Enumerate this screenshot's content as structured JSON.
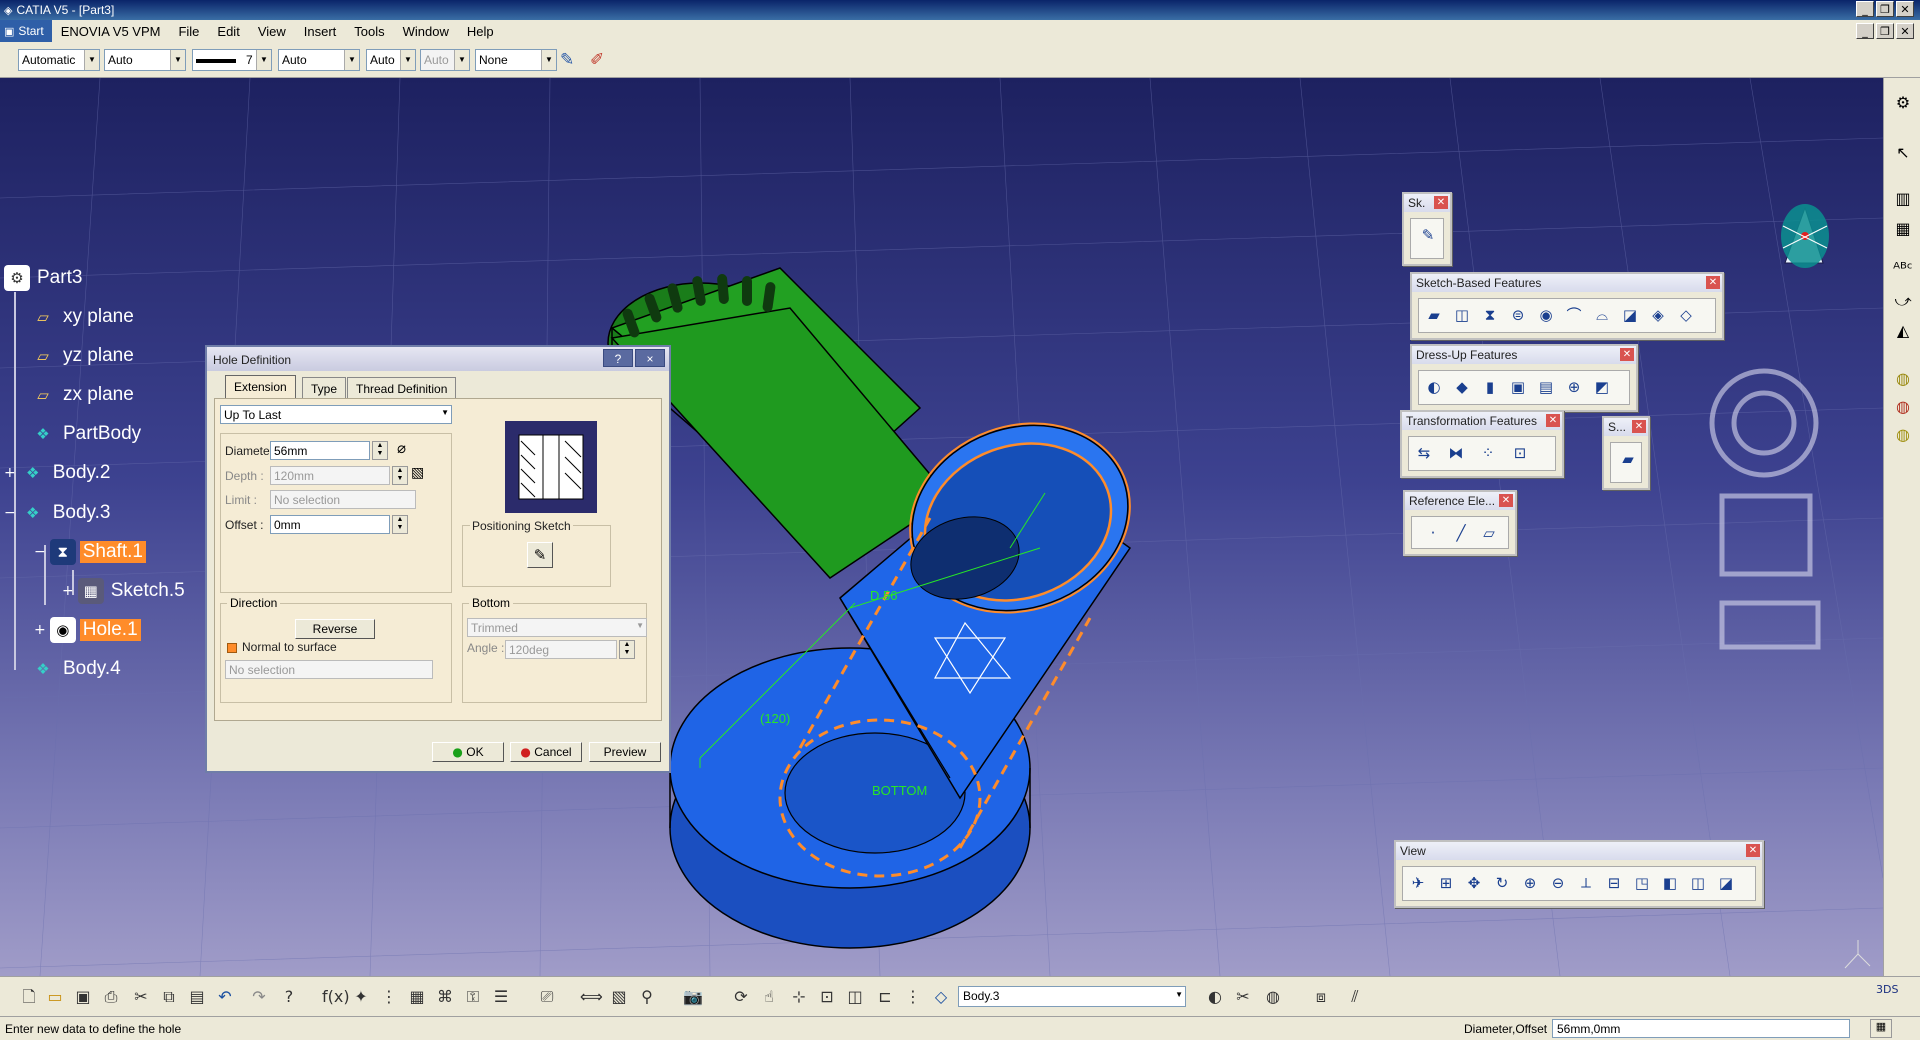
{
  "window": {
    "title": "CATIA V5 - [Part3]"
  },
  "menu": {
    "start": "Start",
    "items": [
      "ENOVIA V5 VPM",
      "File",
      "Edit",
      "View",
      "Insert",
      "Tools",
      "Window",
      "Help"
    ]
  },
  "props": {
    "color": "Automatic",
    "transparency": "Auto",
    "thickness": "7",
    "linetype": "Auto",
    "point": "Auto",
    "layer_disabled": "Auto",
    "layer": "None"
  },
  "tree": {
    "root": "Part3",
    "xy": "xy plane",
    "yz": "yz plane",
    "zx": "zx plane",
    "partbody": "PartBody",
    "body2": "Body.2",
    "body3": "Body.3",
    "shaft1": "Shaft.1",
    "sketch5": "Sketch.5",
    "hole1": "Hole.1",
    "body4": "Body.4"
  },
  "dialog": {
    "title": "Hole Definition",
    "help": "?",
    "close": "×",
    "tabs": [
      "Extension",
      "Type",
      "Thread Definition"
    ],
    "extension_type": "Up To Last",
    "diameter_label": "Diameter :",
    "diameter": "56mm",
    "depth_label": "Depth :",
    "depth": "120mm",
    "limit_label": "Limit :",
    "limit": "No selection",
    "offset_label": "Offset :",
    "offset": "0mm",
    "positioning_sketch": "Positioning Sketch",
    "direction_title": "Direction",
    "reverse": "Reverse",
    "normal_to_surface": "Normal to surface",
    "direction_selection": "No selection",
    "bottom_title": "Bottom",
    "bottom_type": "Trimmed",
    "angle_label": "Angle :",
    "angle": "120deg",
    "ok": "OK",
    "cancel": "Cancel",
    "preview": "Preview"
  },
  "scene": {
    "dim_diameter": "D 56",
    "dim_depth": "(120)",
    "bottom_label": "BOTTOM"
  },
  "toolbars": {
    "sketcher": "Sk.",
    "sketch_based": "Sketch-Based Features",
    "dress_up": "Dress-Up Features",
    "transformation": "Transformation Features",
    "surface": "S...",
    "reference": "Reference Ele...",
    "view": "View"
  },
  "bottom": {
    "current_body": "Body.3"
  },
  "status": {
    "prompt": "Enter new data to define the hole",
    "value_label": "Diameter,Offset",
    "value": "56mm,0mm"
  },
  "colors": {
    "background_top": "#1d2160",
    "background_bottom": "#a09cc8",
    "part_blue": "#1e64e6",
    "part_green": "#1f9a1f",
    "selection_orange": "#ff8c2a"
  }
}
